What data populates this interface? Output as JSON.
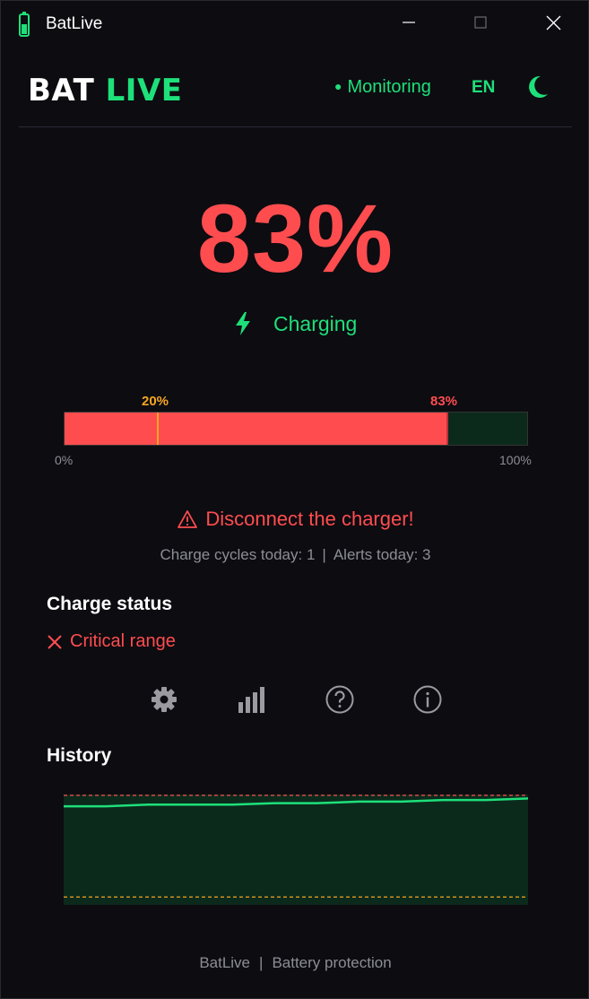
{
  "window": {
    "title": "BatLive",
    "icon": "battery-icon",
    "controls": [
      "minimize-icon",
      "maximize-icon",
      "close-icon"
    ]
  },
  "header": {
    "logo_part1": "BAT",
    "logo_part2": "LIVE",
    "monitoring_dot": "●",
    "monitoring_label": "Monitoring",
    "language": "EN",
    "theme_icon": "moon-icon"
  },
  "battery": {
    "percent_text": "83%",
    "percent": 83,
    "state_label": "Charging",
    "state_icon": "lightning-bolt-icon"
  },
  "bar": {
    "min_threshold": 20,
    "min_label": "20%",
    "current": 83,
    "current_label": "83%",
    "scale_min": "0%",
    "scale_max": "100%"
  },
  "alert": {
    "icon": "warning-triangle-icon",
    "message": "Disconnect the charger!"
  },
  "stats": {
    "cycles": "Charge cycles today: 1",
    "separator": "|",
    "alerts": "Alerts today: 3"
  },
  "charge_status": {
    "title": "Charge status",
    "icon": "x-icon",
    "value": "Critical range"
  },
  "toolbar": [
    "gear-icon",
    "bar-chart-icon",
    "help-icon",
    "info-icon"
  ],
  "history": {
    "title": "History",
    "upper_threshold": 80,
    "lower_threshold": 20,
    "values": [
      78,
      78,
      79,
      79,
      79,
      80,
      80,
      81,
      81,
      82,
      82,
      83
    ]
  },
  "footer": {
    "left": "BatLive",
    "separator": "|",
    "right": "Battery protection"
  },
  "colors": {
    "accent_green": "#1ee07a",
    "alert_red": "#ff4d4f",
    "threshold_orange": "#f5a623",
    "background": "#0d0c11",
    "bar_empty": "#0b2a1c"
  }
}
